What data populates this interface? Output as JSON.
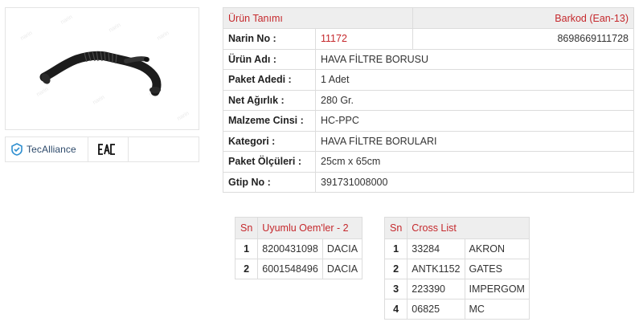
{
  "product": {
    "image_alt": "hava-filtre-borusu-image",
    "logos": {
      "tecalliance": "TecAlliance",
      "eac": "EAC"
    }
  },
  "main_table": {
    "header_left": "Ürün Tanımı",
    "header_right": "Barkod (Ean-13)",
    "rows": [
      {
        "label": "Narin No :",
        "value": "11172",
        "extra": "8698669111728"
      },
      {
        "label": "Ürün Adı :",
        "value": "HAVA FİLTRE BORUSU",
        "extra": ""
      },
      {
        "label": "Paket Adedi :",
        "value": "1 Adet",
        "extra": ""
      },
      {
        "label": "Net Ağırlık :",
        "value": "280 Gr.",
        "extra": ""
      },
      {
        "label": "Malzeme Cinsi :",
        "value": "HC-PPC",
        "extra": ""
      },
      {
        "label": "Kategori :",
        "value": "HAVA FİLTRE BORULARI",
        "extra": ""
      },
      {
        "label": "Paket Ölçüleri :",
        "value": "25cm x 65cm",
        "extra": ""
      },
      {
        "label": "Gtip No :",
        "value": "391731008000",
        "extra": ""
      }
    ]
  },
  "oem_table": {
    "header_sn": "Sn",
    "header_title": "Uyumlu Oem'ler - 2",
    "rows": [
      {
        "sn": "1",
        "code": "8200431098",
        "brand": "DACIA"
      },
      {
        "sn": "2",
        "code": "6001548496",
        "brand": "DACIA"
      }
    ]
  },
  "cross_table": {
    "header_sn": "Sn",
    "header_title": "Cross List",
    "rows": [
      {
        "sn": "1",
        "code": "33284",
        "brand": "AKRON"
      },
      {
        "sn": "2",
        "code": "ANTK1152",
        "brand": "GATES"
      },
      {
        "sn": "3",
        "code": "223390",
        "brand": "IMPERGOM"
      },
      {
        "sn": "4",
        "code": "06825",
        "brand": "MC"
      }
    ]
  },
  "colors": {
    "accent_red": "#c5282c",
    "header_bg": "#eeeeee",
    "border": "#dcdcdc"
  }
}
